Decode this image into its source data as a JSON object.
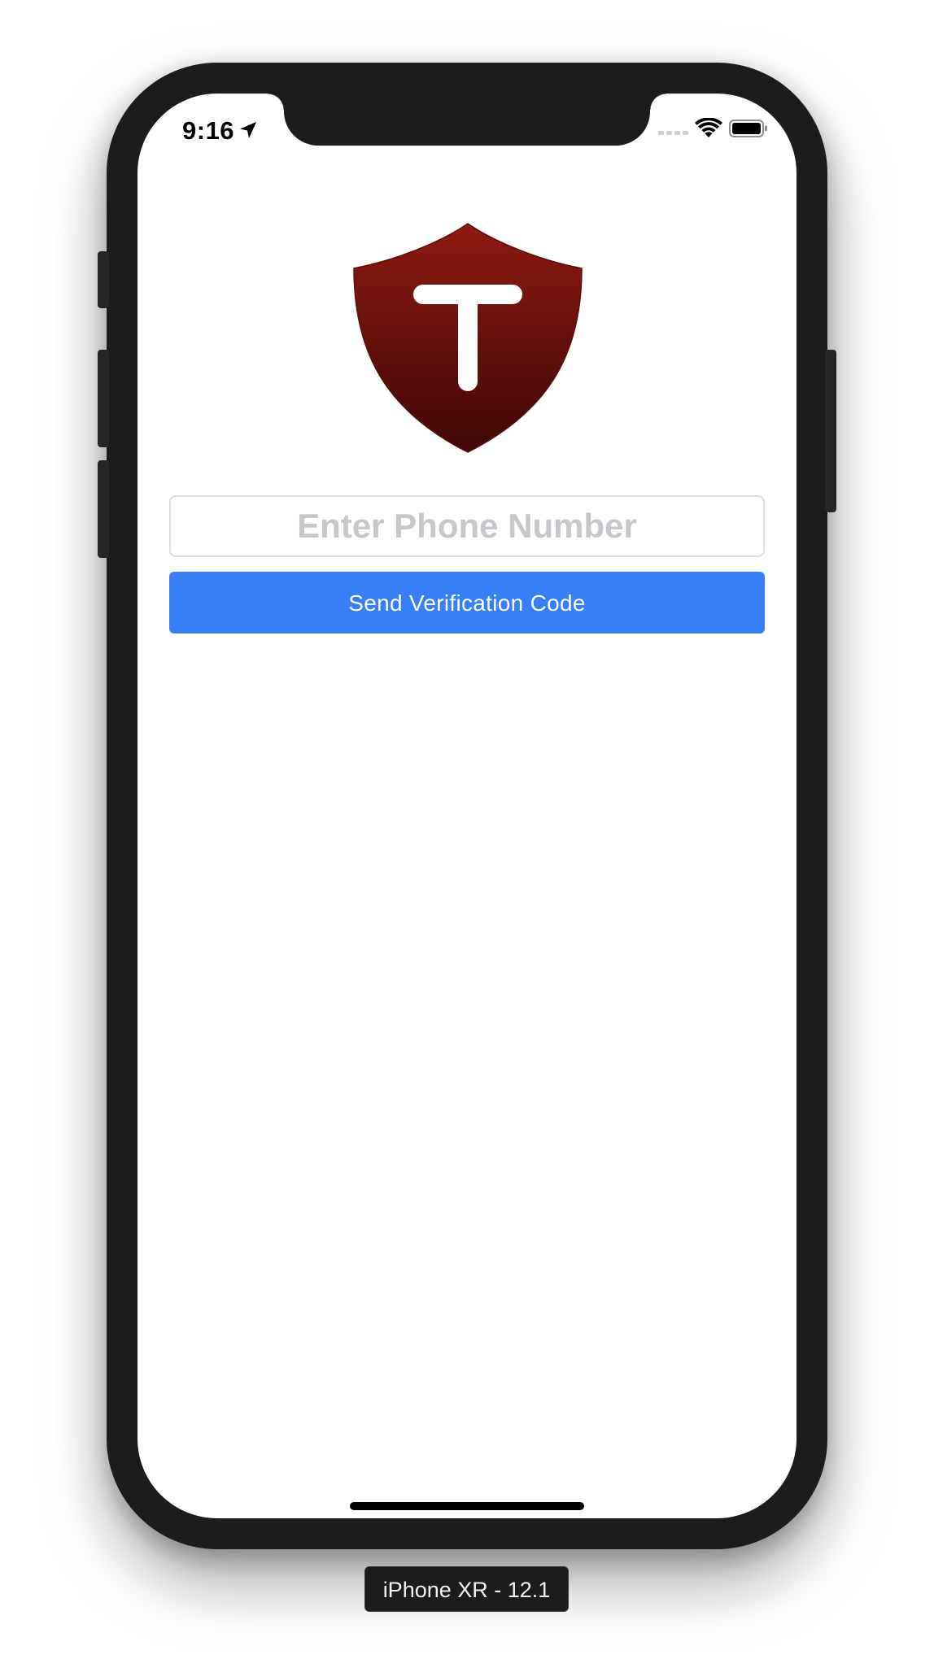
{
  "status_bar": {
    "time": "9:16",
    "icons": [
      "location-arrow-icon",
      "cellular-signal-icon",
      "wifi-icon",
      "battery-icon"
    ]
  },
  "logo": {
    "letter": "T",
    "icon": "shield-icon",
    "colors": {
      "top": "#8f1a12",
      "bottom": "#3e0706",
      "letter": "#ffffff"
    }
  },
  "phone_input": {
    "placeholder": "Enter Phone Number",
    "value": ""
  },
  "send_button": {
    "label": "Send Verification Code",
    "color": "#377ef7"
  },
  "simulator_label": "iPhone XR - 12.1"
}
